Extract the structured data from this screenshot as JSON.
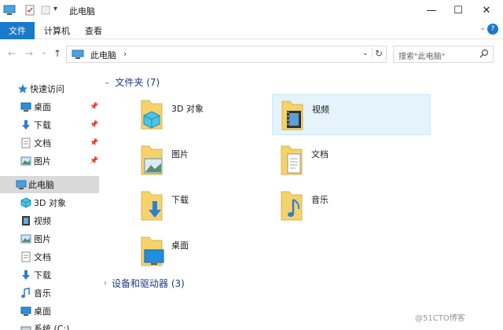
{
  "window": {
    "title": "此电脑",
    "minimize_glyph": "—",
    "maximize_glyph": "☐",
    "close_glyph": "✕"
  },
  "ribbon": {
    "tabs": [
      {
        "label": "文件",
        "active": true
      },
      {
        "label": "计算机"
      },
      {
        "label": "查看"
      }
    ],
    "expand_glyph": "⌄",
    "help_glyph": "?"
  },
  "address": {
    "back_glyph": "←",
    "forward_glyph": "→",
    "recent_glyph": "⌄",
    "up_glyph": "↑",
    "path": "此电脑",
    "separator": "›",
    "dropdown_glyph": "⌄",
    "refresh_glyph": "↻"
  },
  "search": {
    "placeholder": "搜索\"此电脑\""
  },
  "sidebar": {
    "items": [
      {
        "label": "快速访问",
        "icon": "star-icon"
      },
      {
        "label": "桌面",
        "icon": "desktop-icon",
        "pinned": true
      },
      {
        "label": "下载",
        "icon": "download-icon",
        "pinned": true
      },
      {
        "label": "文档",
        "icon": "document-icon",
        "pinned": true
      },
      {
        "label": "图片",
        "icon": "picture-icon",
        "pinned": true
      },
      {
        "label": "此电脑",
        "icon": "computer-icon",
        "selected": true
      },
      {
        "label": "3D 对象",
        "icon": "cube-icon"
      },
      {
        "label": "视频",
        "icon": "video-icon"
      },
      {
        "label": "图片",
        "icon": "picture-icon"
      },
      {
        "label": "文档",
        "icon": "document-icon"
      },
      {
        "label": "下载",
        "icon": "download-icon"
      },
      {
        "label": "音乐",
        "icon": "music-icon"
      },
      {
        "label": "桌面",
        "icon": "desktop-icon"
      },
      {
        "label": "系统 (C:)",
        "icon": "drive-icon"
      }
    ],
    "pin_glyph": "📌"
  },
  "main": {
    "folders_group": {
      "label": "文件夹 (7)",
      "chevron": "⌄"
    },
    "folders": [
      {
        "label": "3D 对象",
        "icon": "cube-icon"
      },
      {
        "label": "视频",
        "icon": "video-icon",
        "selected": true
      },
      {
        "label": "图片",
        "icon": "picture-icon"
      },
      {
        "label": "文档",
        "icon": "document-icon"
      },
      {
        "label": "下载",
        "icon": "download-icon"
      },
      {
        "label": "音乐",
        "icon": "music-icon"
      },
      {
        "label": "桌面",
        "icon": "desktop-icon"
      }
    ],
    "devices_group": {
      "label": "设备和驱动器 (3)",
      "chevron": "›"
    }
  },
  "watermark": "@51CTO博客",
  "colors": {
    "accent": "#1979ca",
    "group_heading": "#1e3a8a",
    "folder": "#f6d26b",
    "selection": "#e5f3fb"
  }
}
